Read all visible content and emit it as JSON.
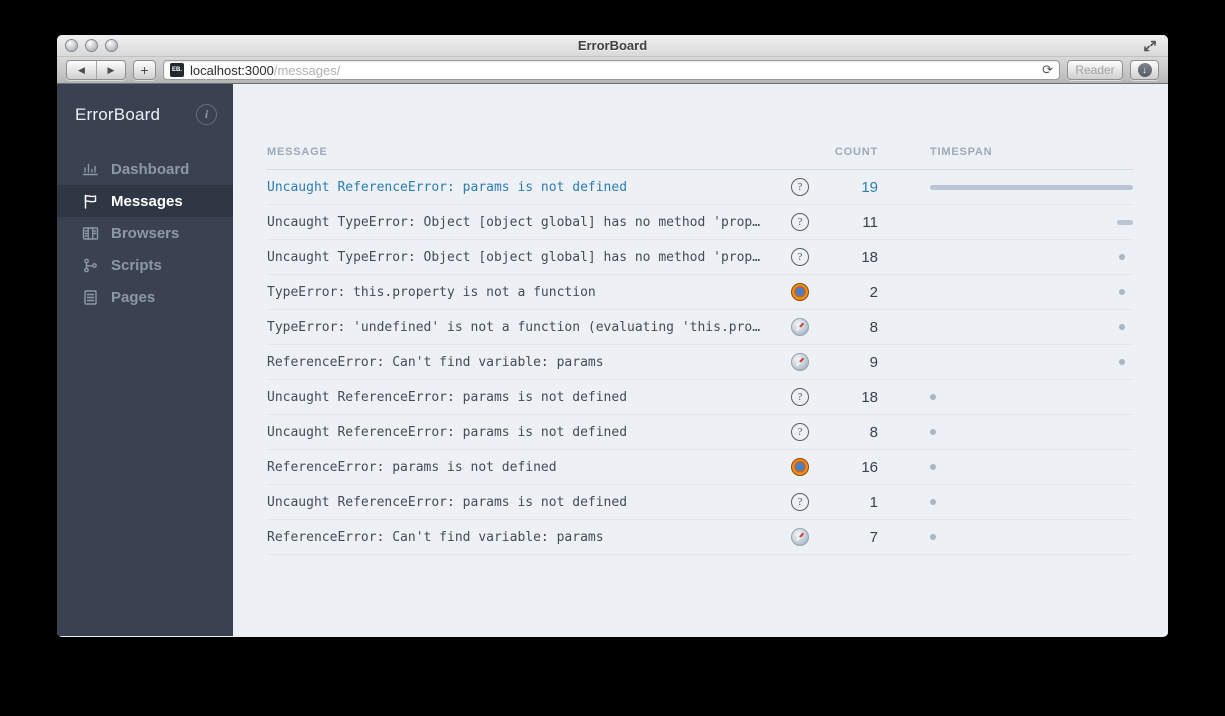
{
  "chrome": {
    "window_title": "ErrorBoard",
    "url_host": "localhost:3000",
    "url_path": "/messages/",
    "reader_label": "Reader",
    "favicon_text": "EB.",
    "back_glyph": "◀",
    "forward_glyph": "▶",
    "new_tab_glyph": "+",
    "refresh_glyph": "⟳",
    "download_glyph": "↓"
  },
  "sidebar": {
    "app_name": "ErrorBoard",
    "items": [
      {
        "label": "Dashboard",
        "icon": "bar-chart-icon",
        "active": false
      },
      {
        "label": "Messages",
        "icon": "flag-icon",
        "active": true
      },
      {
        "label": "Browsers",
        "icon": "columns-icon",
        "active": false
      },
      {
        "label": "Scripts",
        "icon": "branch-icon",
        "active": false
      },
      {
        "label": "Pages",
        "icon": "document-icon",
        "active": false
      }
    ]
  },
  "table": {
    "headers": [
      "MESSAGE",
      "COUNT",
      "TIMESPAN"
    ],
    "rows": [
      {
        "message": "Uncaught ReferenceError: params is not defined",
        "browser": "unknown",
        "count": 19,
        "highlighted": true,
        "timespan": {
          "start_pct": 0,
          "end_pct": 100
        }
      },
      {
        "message": "Uncaught TypeError: Object [object global] has no method 'prop…",
        "browser": "unknown",
        "count": 11,
        "highlighted": false,
        "timespan": {
          "start_pct": 92,
          "end_pct": 100
        }
      },
      {
        "message": "Uncaught TypeError: Object [object global] has no method 'prop…",
        "browser": "unknown",
        "count": 18,
        "highlighted": false,
        "timespan": {
          "start_pct": 94.5,
          "end_pct": 94.5
        }
      },
      {
        "message": "TypeError: this.property is not a function",
        "browser": "firefox",
        "count": 2,
        "highlighted": false,
        "timespan": {
          "start_pct": 94.5,
          "end_pct": 94.5
        }
      },
      {
        "message": "TypeError: 'undefined' is not a function (evaluating 'this.pro…",
        "browser": "safari",
        "count": 8,
        "highlighted": false,
        "timespan": {
          "start_pct": 94.5,
          "end_pct": 94.5
        }
      },
      {
        "message": "ReferenceError: Can't find variable: params",
        "browser": "safari",
        "count": 9,
        "highlighted": false,
        "timespan": {
          "start_pct": 94.5,
          "end_pct": 94.5
        }
      },
      {
        "message": "Uncaught ReferenceError: params is not defined",
        "browser": "unknown",
        "count": 18,
        "highlighted": false,
        "timespan": {
          "start_pct": 1.5,
          "end_pct": 1.5
        }
      },
      {
        "message": "Uncaught ReferenceError: params is not defined",
        "browser": "unknown",
        "count": 8,
        "highlighted": false,
        "timespan": {
          "start_pct": 1.5,
          "end_pct": 1.5
        }
      },
      {
        "message": "ReferenceError: params is not defined",
        "browser": "firefox",
        "count": 16,
        "highlighted": false,
        "timespan": {
          "start_pct": 1.5,
          "end_pct": 1.5
        }
      },
      {
        "message": "Uncaught ReferenceError: params is not defined",
        "browser": "unknown",
        "count": 1,
        "highlighted": false,
        "timespan": {
          "start_pct": 1.5,
          "end_pct": 1.5
        }
      },
      {
        "message": "ReferenceError: Can't find variable: params",
        "browser": "safari",
        "count": 7,
        "highlighted": false,
        "timespan": {
          "start_pct": 1.5,
          "end_pct": 1.5
        }
      }
    ]
  },
  "colors": {
    "accent_blue": "#2d7db3",
    "sidebar_bg": "#3a4252",
    "sidebar_active_bg": "#303744",
    "content_bg": "#edf1f5",
    "timespan_bar": "#b9c5d2",
    "timespan_dot": "#a9b6c5"
  }
}
